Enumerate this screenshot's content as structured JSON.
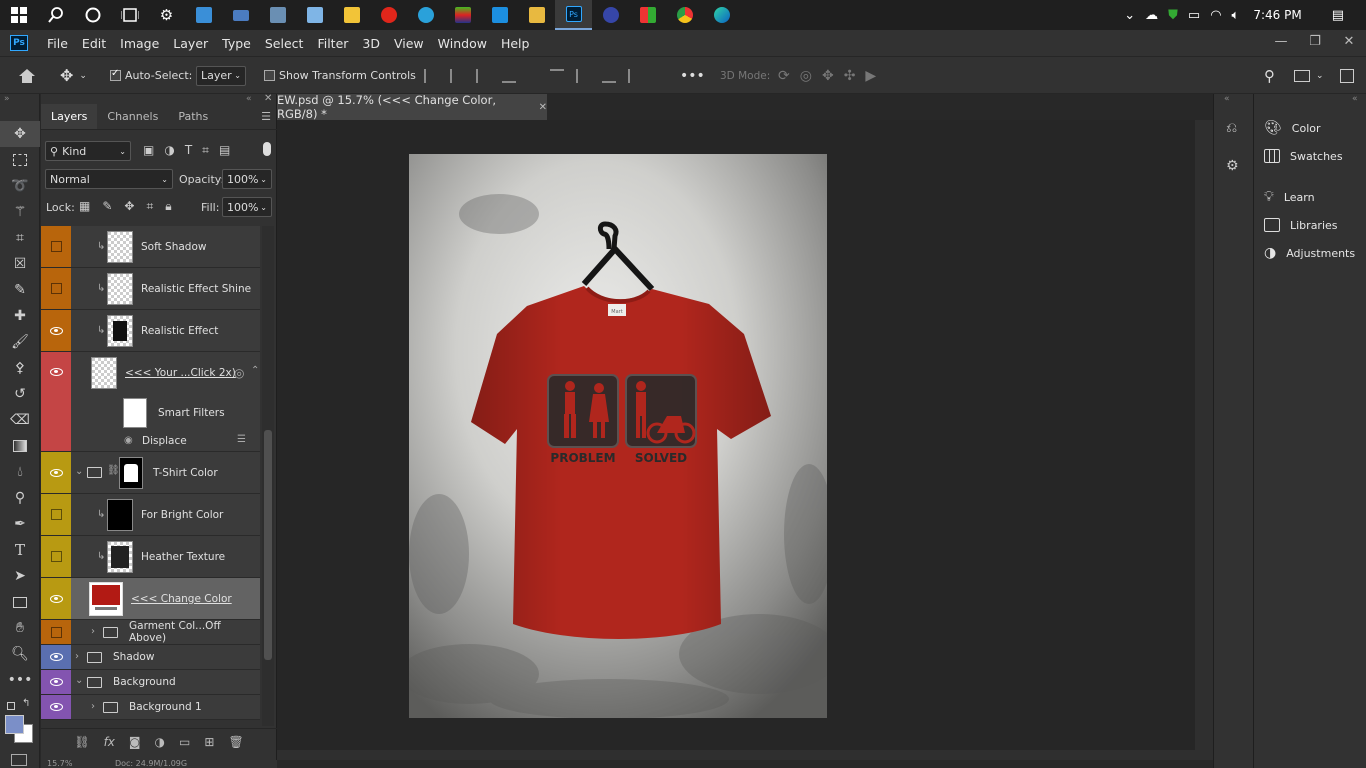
{
  "taskbar": {
    "time": "7:46 PM"
  },
  "menubar": {
    "logo": "Ps",
    "items": [
      "File",
      "Edit",
      "Image",
      "Layer",
      "Type",
      "Select",
      "Filter",
      "3D",
      "View",
      "Window",
      "Help"
    ]
  },
  "options": {
    "auto_select_label": "Auto-Select:",
    "auto_select_value": "Layer",
    "transform_label": "Show Transform Controls",
    "mode_label": "3D Mode:"
  },
  "layers_panel": {
    "tabs": [
      "Layers",
      "Channels",
      "Paths"
    ],
    "kind": "Kind",
    "blend_mode": "Normal",
    "opacity_label": "Opacity:",
    "opacity": "100%",
    "lock_label": "Lock:",
    "fill_label": "Fill:",
    "fill": "100%",
    "layers": [
      {
        "name": "Soft Shadow",
        "color": "#b8650c",
        "visible": false
      },
      {
        "name": "Realistic Effect Shine",
        "color": "#b8650c",
        "visible": false
      },
      {
        "name": "Realistic Effect",
        "color": "#b8650c",
        "visible": true
      },
      {
        "name": "<<< Your ...Click 2x) ",
        "color": "#c44545",
        "visible": true
      },
      {
        "name": "Smart Filters",
        "color": "#c44545"
      },
      {
        "name": "Displace",
        "color": "#c44545"
      },
      {
        "name": "T-Shirt Color",
        "color": "#b89a12",
        "visible": true
      },
      {
        "name": "For Bright Color",
        "color": "#b89a12",
        "visible": false
      },
      {
        "name": "Heather Texture",
        "color": "#b89a12",
        "visible": false
      },
      {
        "name": "<<< Change Color ",
        "color": "#b89a12",
        "visible": true
      },
      {
        "name": "Garment Col...Off Above)",
        "color": "#b8650c",
        "visible": false
      },
      {
        "name": "Shadow",
        "color": "#5a6fb0",
        "visible": true
      },
      {
        "name": "Background",
        "color": "#8354b0",
        "visible": true
      },
      {
        "name": "Background 1",
        "color": "#8354b0",
        "visible": true
      }
    ]
  },
  "document": {
    "tab_title": "EW.psd @ 15.7% (<<< Change Color, RGB/8) *",
    "zoom_status": "15.7%",
    "doc_status": "Doc: 24.9M/1.09G"
  },
  "artwork": {
    "shirt_color": "#b0261d",
    "print_left": "PROBLEM",
    "print_right": "SOLVED",
    "tag": "Mart"
  },
  "right_panels": [
    "Color",
    "Swatches",
    "Learn",
    "Libraries",
    "Adjustments"
  ]
}
